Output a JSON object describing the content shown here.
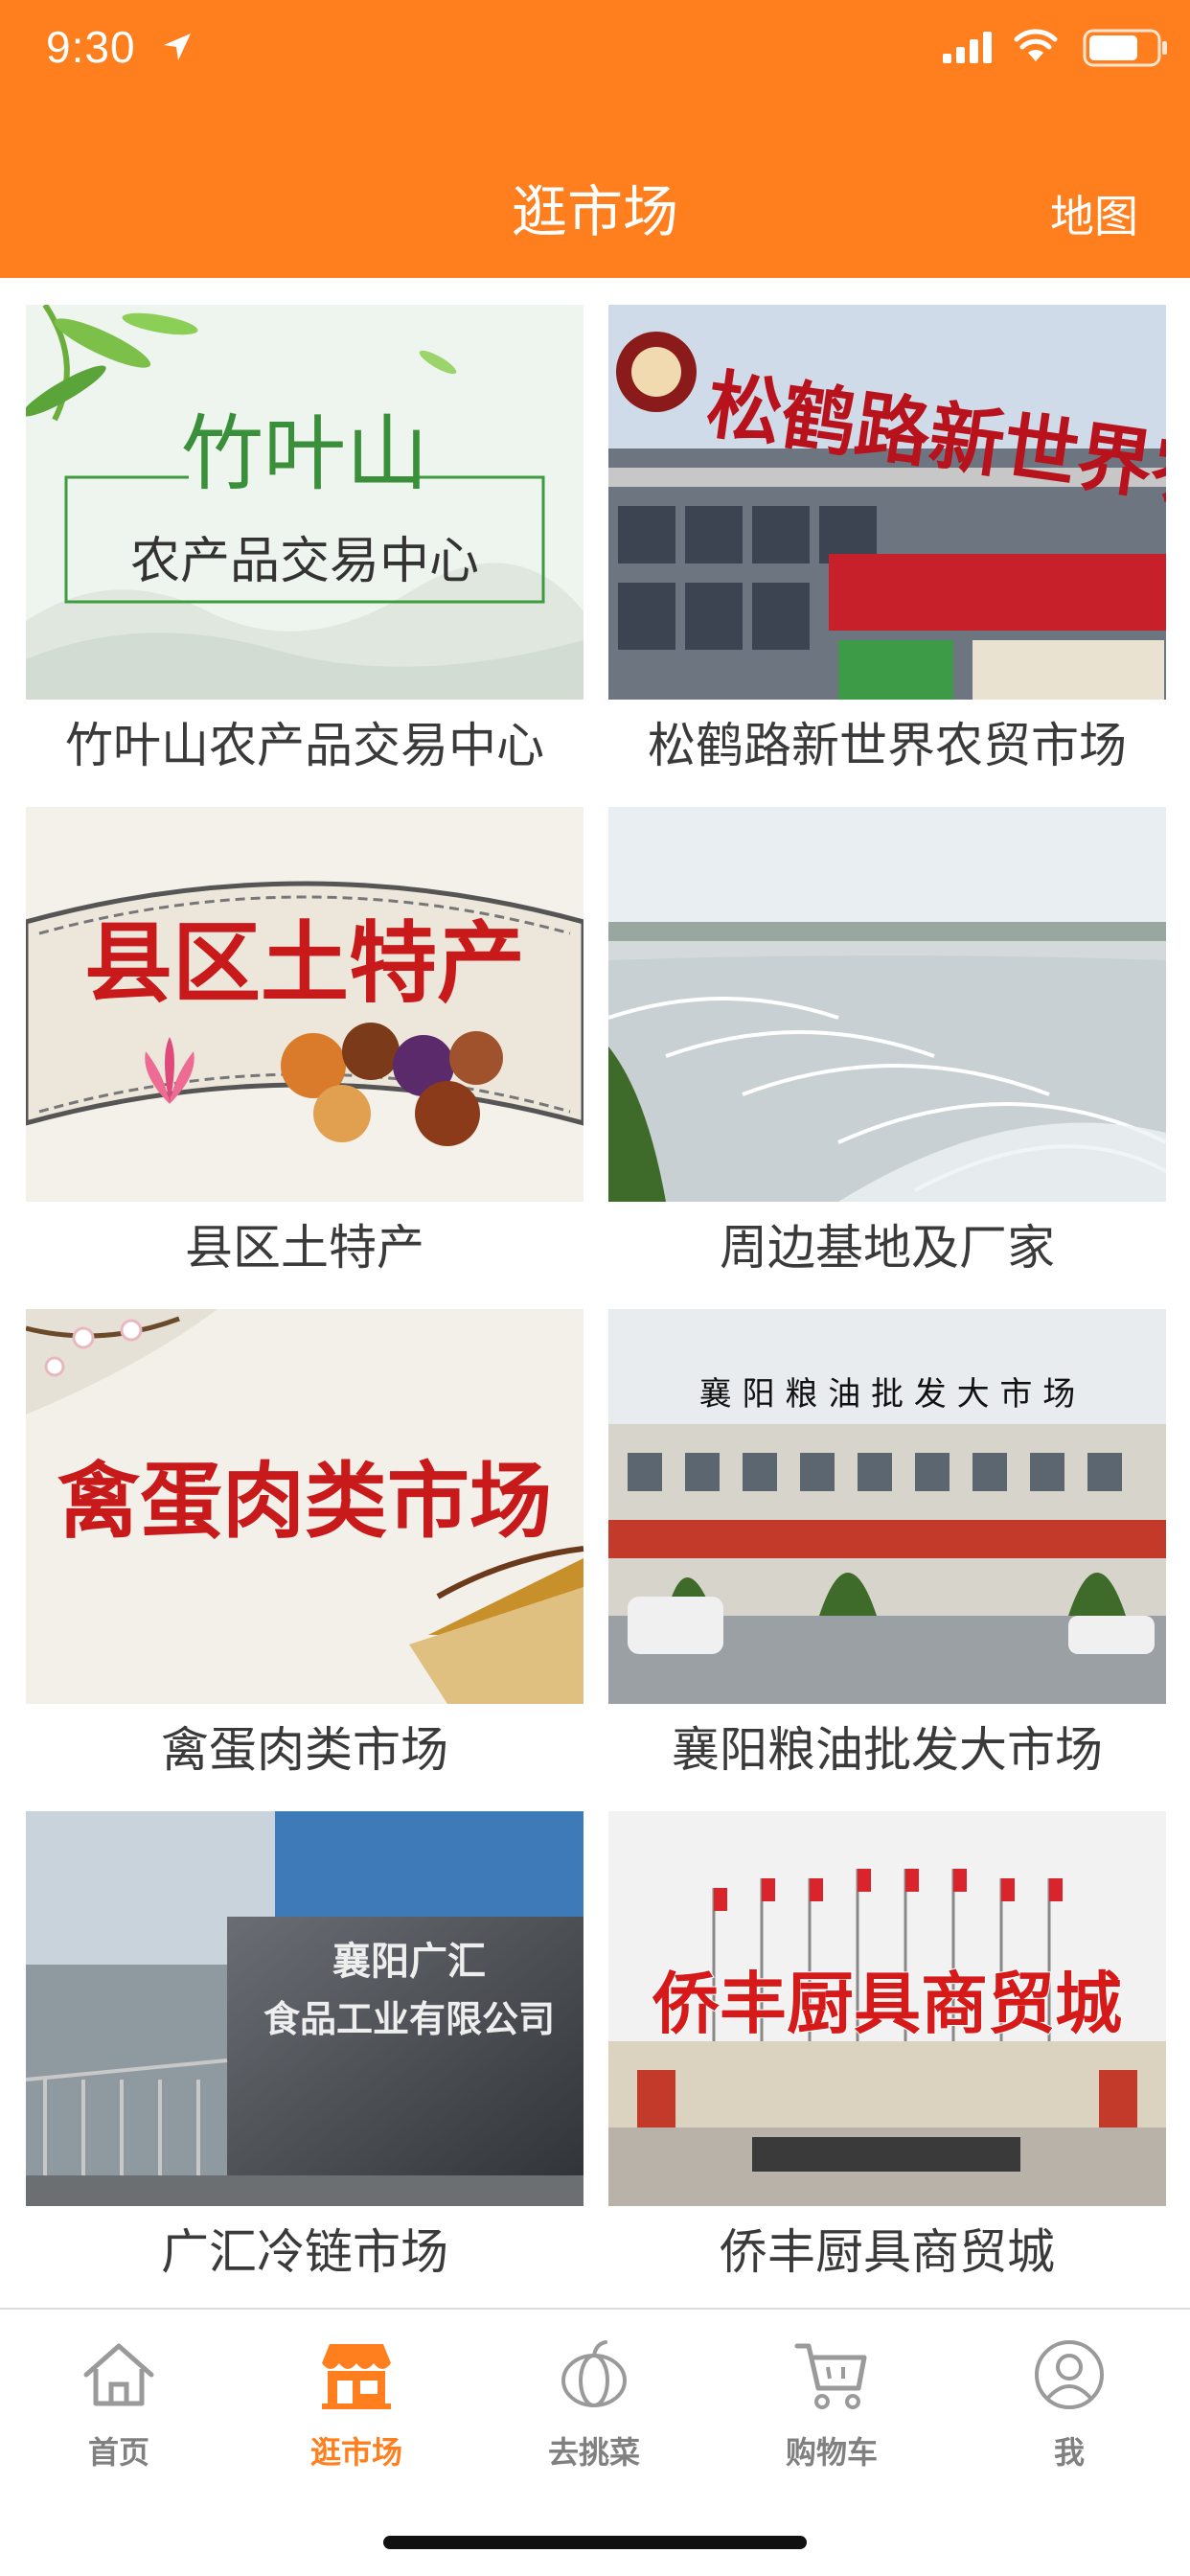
{
  "status_bar": {
    "time": "9:30",
    "icons": [
      "location-arrow-icon",
      "signal-icon",
      "wifi-icon",
      "battery-icon"
    ]
  },
  "nav": {
    "title": "逛市场",
    "map_label": "地图"
  },
  "markets": [
    {
      "name": "竹叶山农产品交易中心",
      "sign_text": "竹叶山",
      "sign_sub": "农产品交易中心"
    },
    {
      "name": "松鹤路新世界农贸市场",
      "sign_text": "松鹤路新世界农贸市场"
    },
    {
      "name": "县区土特产",
      "sign_text": "县区土特产"
    },
    {
      "name": "周边基地及厂家"
    },
    {
      "name": "禽蛋肉类市场",
      "sign_text": "禽蛋肉类市场"
    },
    {
      "name": "襄阳粮油批发大市场",
      "sign_text": "襄 阳 粮 油 批 发 大 市 场"
    },
    {
      "name": "广汇冷链市场",
      "sign_text": "襄阳广汇",
      "sign_sub": "食品工业有限公司"
    },
    {
      "name": "侨丰厨具商贸城",
      "sign_text": "侨丰厨具商贸城"
    }
  ],
  "tabs": [
    {
      "label": "首页",
      "icon": "home-icon",
      "active": false
    },
    {
      "label": "逛市场",
      "icon": "market-stall-icon",
      "active": true
    },
    {
      "label": "去挑菜",
      "icon": "pumpkin-icon",
      "active": false
    },
    {
      "label": "购物车",
      "icon": "cart-icon",
      "active": false
    },
    {
      "label": "我",
      "icon": "user-icon",
      "active": false
    }
  ],
  "colors": {
    "accent": "#ff7f1f",
    "tab_inactive": "#808080",
    "label_text": "#3a3a3a"
  }
}
